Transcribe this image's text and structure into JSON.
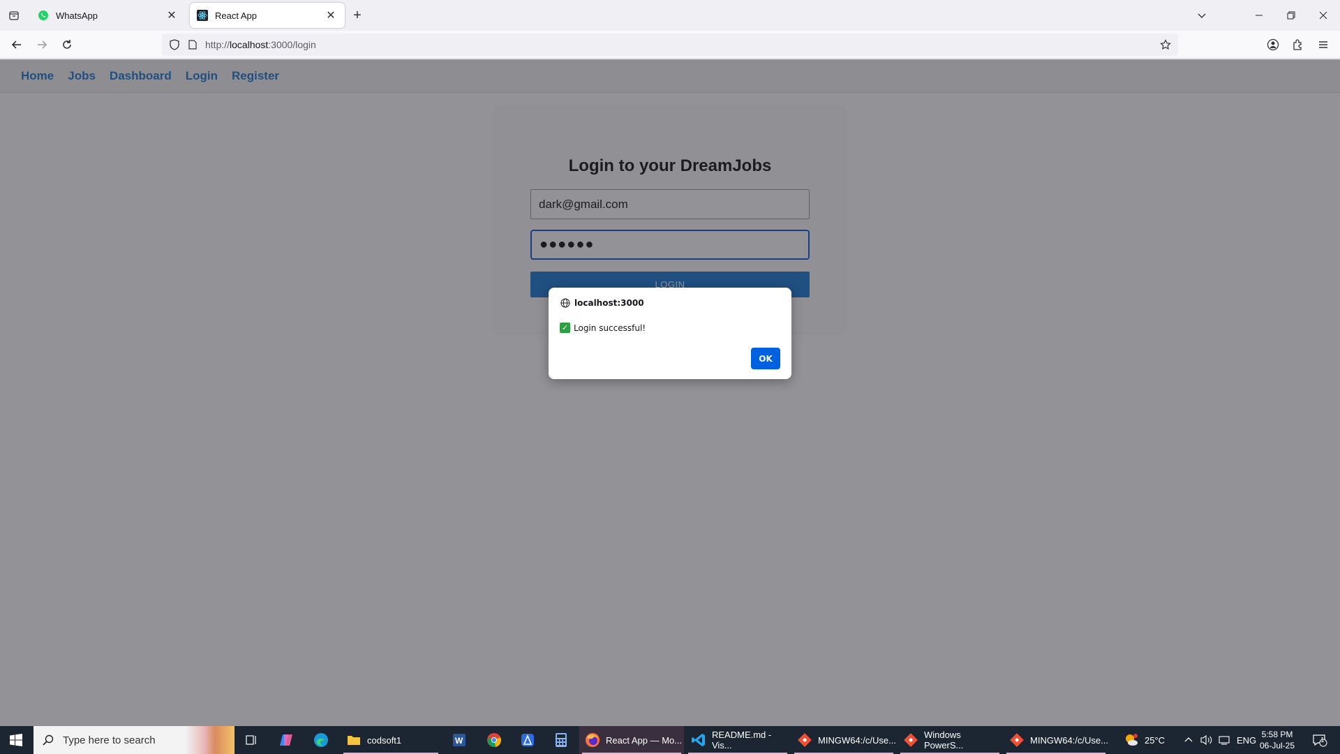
{
  "browser": {
    "tabs": [
      {
        "title": "WhatsApp",
        "icon": "whatsapp-icon"
      },
      {
        "title": "React App",
        "icon": "react-icon"
      }
    ],
    "url_prefix": "http://",
    "url_host": "localhost",
    "url_path": ":3000/login"
  },
  "app": {
    "nav": [
      "Home",
      "Jobs",
      "Dashboard",
      "Login",
      "Register"
    ],
    "heading": "Login to your DreamJobs",
    "email_value": "dark@gmail.com",
    "password_mask": "●●●●●●",
    "login_label": "LOGIN",
    "accent": "#1976d2"
  },
  "dialog": {
    "origin": "localhost:3000",
    "message": "Login successful!",
    "ok_label": "OK"
  },
  "taskbar": {
    "search_placeholder": "Type here to search",
    "apps": [
      {
        "label": "codsoft1",
        "icon": "folder-icon"
      },
      {
        "label": "React App — Mo...",
        "icon": "firefox-icon"
      },
      {
        "label": "README.md - Vis...",
        "icon": "vscode-icon"
      },
      {
        "label": "MINGW64:/c/Use...",
        "icon": "git-icon"
      },
      {
        "label": "Windows PowerS...",
        "icon": "git-icon"
      },
      {
        "label": "MINGW64:/c/Use...",
        "icon": "git-icon"
      }
    ],
    "temperature": "25°C",
    "language": "ENG",
    "time": "5:58 PM",
    "date": "06-Jul-25",
    "notifications": "1"
  }
}
